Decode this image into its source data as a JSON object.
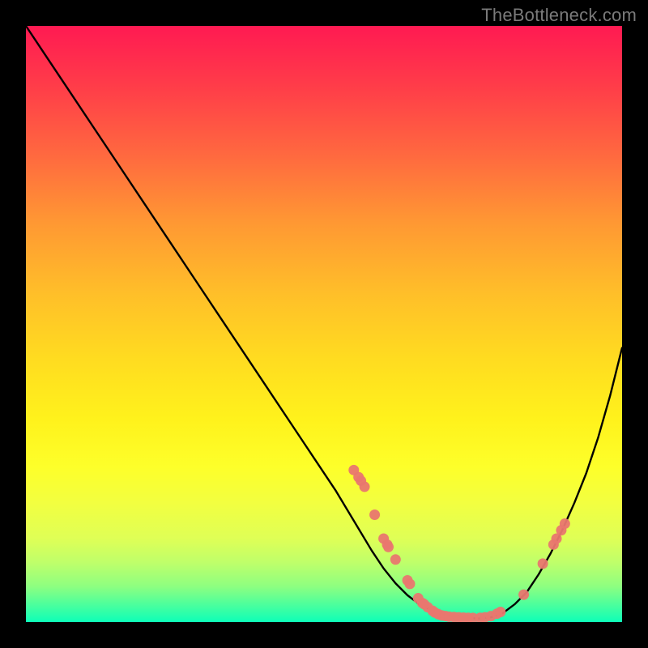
{
  "watermark": "TheBottleneck.com",
  "colors": {
    "grad_top": "#ff1a52",
    "grad_bottom": "#0dffb8",
    "curve_stroke": "#000000",
    "dot_fill": "#e9776f",
    "frame": "#000000"
  },
  "chart_data": {
    "type": "line",
    "title": "",
    "xlabel": "",
    "ylabel": "",
    "xlim": [
      0,
      100
    ],
    "ylim": [
      0,
      100
    ],
    "series": [
      {
        "name": "bottleneck_curve",
        "x": [
          0,
          4,
          8,
          12,
          16,
          20,
          24,
          28,
          32,
          36,
          40,
          44,
          48,
          52,
          55,
          58,
          60,
          62,
          64,
          66,
          68,
          70,
          72,
          74,
          76,
          78,
          80,
          82,
          84,
          86,
          88,
          90,
          92,
          94,
          96,
          98,
          100
        ],
        "y": [
          100,
          94,
          88,
          82,
          76,
          70,
          64,
          58,
          52,
          46,
          40,
          34,
          28,
          22,
          17,
          12,
          9,
          6.5,
          4.5,
          3,
          2,
          1.3,
          0.9,
          0.7,
          0.6,
          0.8,
          1.5,
          3,
          5,
          8,
          11.5,
          15.5,
          20,
          25,
          31,
          38,
          46
        ]
      }
    ],
    "points": [
      {
        "x": 55.0,
        "y": 25.5
      },
      {
        "x": 55.8,
        "y": 24.3
      },
      {
        "x": 56.2,
        "y": 23.7
      },
      {
        "x": 56.8,
        "y": 22.7
      },
      {
        "x": 58.5,
        "y": 18.0
      },
      {
        "x": 60.0,
        "y": 14.0
      },
      {
        "x": 60.6,
        "y": 13.0
      },
      {
        "x": 60.8,
        "y": 12.6
      },
      {
        "x": 62.0,
        "y": 10.5
      },
      {
        "x": 64.0,
        "y": 7.0
      },
      {
        "x": 64.4,
        "y": 6.4
      },
      {
        "x": 65.8,
        "y": 4.0
      },
      {
        "x": 66.5,
        "y": 3.2
      },
      {
        "x": 66.8,
        "y": 3.0
      },
      {
        "x": 67.4,
        "y": 2.5
      },
      {
        "x": 68.2,
        "y": 1.9
      },
      {
        "x": 68.6,
        "y": 1.6
      },
      {
        "x": 69.2,
        "y": 1.3
      },
      {
        "x": 69.8,
        "y": 1.1
      },
      {
        "x": 70.4,
        "y": 1.0
      },
      {
        "x": 71.0,
        "y": 0.9
      },
      {
        "x": 71.8,
        "y": 0.85
      },
      {
        "x": 72.6,
        "y": 0.8
      },
      {
        "x": 73.4,
        "y": 0.75
      },
      {
        "x": 74.2,
        "y": 0.72
      },
      {
        "x": 75.0,
        "y": 0.7
      },
      {
        "x": 76.2,
        "y": 0.72
      },
      {
        "x": 77.0,
        "y": 0.8
      },
      {
        "x": 78.0,
        "y": 1.0
      },
      {
        "x": 79.0,
        "y": 1.4
      },
      {
        "x": 79.6,
        "y": 1.7
      },
      {
        "x": 83.5,
        "y": 4.6
      },
      {
        "x": 86.7,
        "y": 9.8
      },
      {
        "x": 88.5,
        "y": 13.0
      },
      {
        "x": 89.0,
        "y": 14.0
      },
      {
        "x": 89.8,
        "y": 15.4
      },
      {
        "x": 90.4,
        "y": 16.5
      }
    ]
  }
}
